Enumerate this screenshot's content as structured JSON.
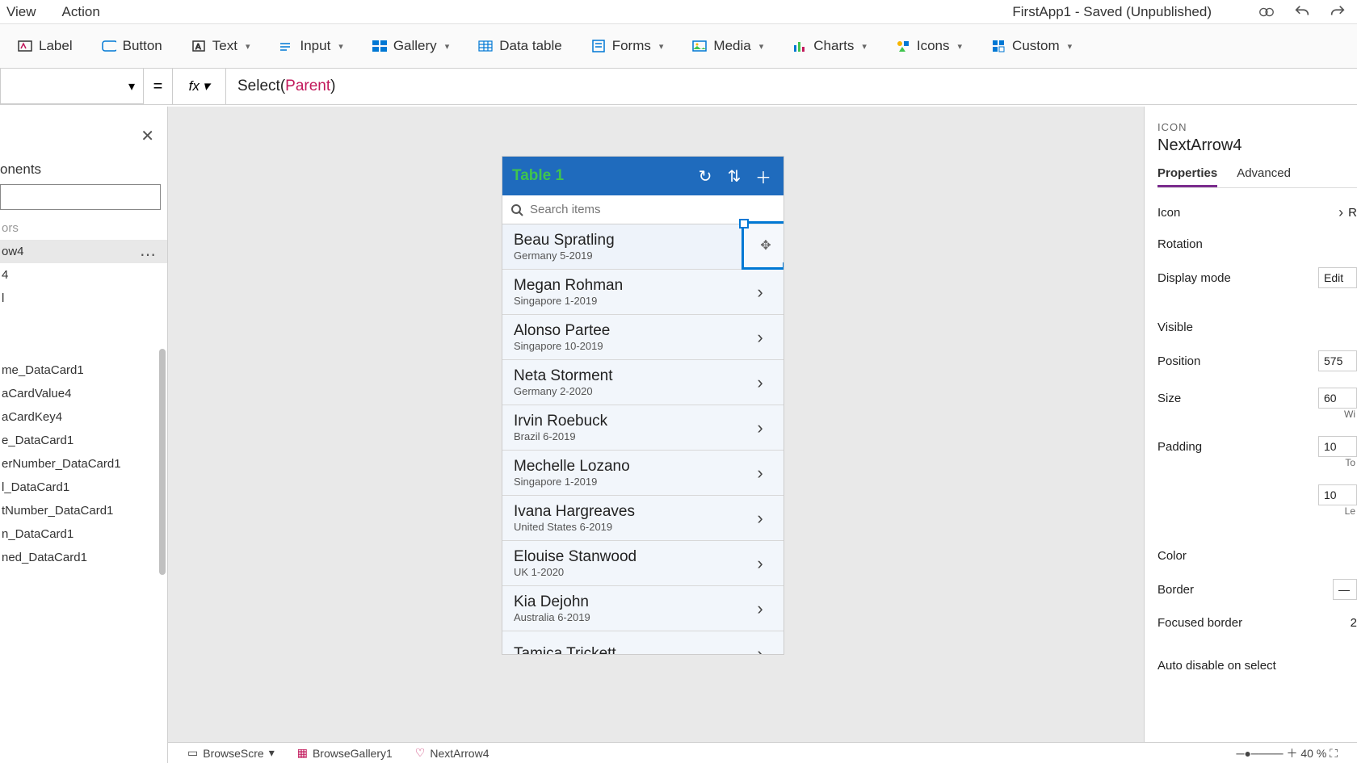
{
  "menubar": {
    "view": "View",
    "action": "Action",
    "title": "FirstApp1 - Saved (Unpublished)"
  },
  "ribbon": {
    "label": "Label",
    "button": "Button",
    "text": "Text",
    "input": "Input",
    "gallery": "Gallery",
    "datatable": "Data table",
    "forms": "Forms",
    "media": "Media",
    "charts": "Charts",
    "icons": "Icons",
    "custom": "Custom"
  },
  "formula": {
    "fn": "Select",
    "arg": "Parent"
  },
  "tree": {
    "header": "onents",
    "items": [
      "ors",
      "ow4",
      "4",
      "l",
      "me_DataCard1",
      "aCardValue4",
      "aCardKey4",
      "e_DataCard1",
      "erNumber_DataCard1",
      "l_DataCard1",
      "tNumber_DataCard1",
      "n_DataCard1",
      "ned_DataCard1"
    ],
    "selected_index": 1
  },
  "phone": {
    "title": "Table 1",
    "search_placeholder": "Search items",
    "rows": [
      {
        "name": "Beau Spratling",
        "sub": "Germany 5-2019"
      },
      {
        "name": "Megan Rohman",
        "sub": "Singapore 1-2019"
      },
      {
        "name": "Alonso Partee",
        "sub": "Singapore 10-2019"
      },
      {
        "name": "Neta Storment",
        "sub": "Germany 2-2020"
      },
      {
        "name": "Irvin Roebuck",
        "sub": "Brazil 6-2019"
      },
      {
        "name": "Mechelle Lozano",
        "sub": "Singapore 1-2019"
      },
      {
        "name": "Ivana Hargreaves",
        "sub": "United States 6-2019"
      },
      {
        "name": "Elouise Stanwood",
        "sub": "UK 1-2020"
      },
      {
        "name": "Kia Dejohn",
        "sub": "Australia 6-2019"
      },
      {
        "name": "Tamica Trickett",
        "sub": ""
      }
    ]
  },
  "props": {
    "kind": "ICON",
    "name": "NextArrow4",
    "tab_properties": "Properties",
    "tab_advanced": "Advanced",
    "icon_label": "Icon",
    "icon_val": "R",
    "rotation_label": "Rotation",
    "displaymode_label": "Display mode",
    "displaymode_val": "Edit",
    "visible_label": "Visible",
    "position_label": "Position",
    "position_val": "575",
    "size_label": "Size",
    "size_val": "60",
    "size_sub": "Wi",
    "padding_label": "Padding",
    "padding_top": "10",
    "padding_top_sub": "To",
    "padding_left": "10",
    "padding_left_sub": "Le",
    "color_label": "Color",
    "border_label": "Border",
    "focused_label": "Focused border",
    "focused_val": "2",
    "autodisable_label": "Auto disable on select"
  },
  "status": {
    "crumb1": "BrowseScre",
    "crumb2": "BrowseGallery1",
    "crumb3": "NextArrow4",
    "zoom": "40 %"
  }
}
